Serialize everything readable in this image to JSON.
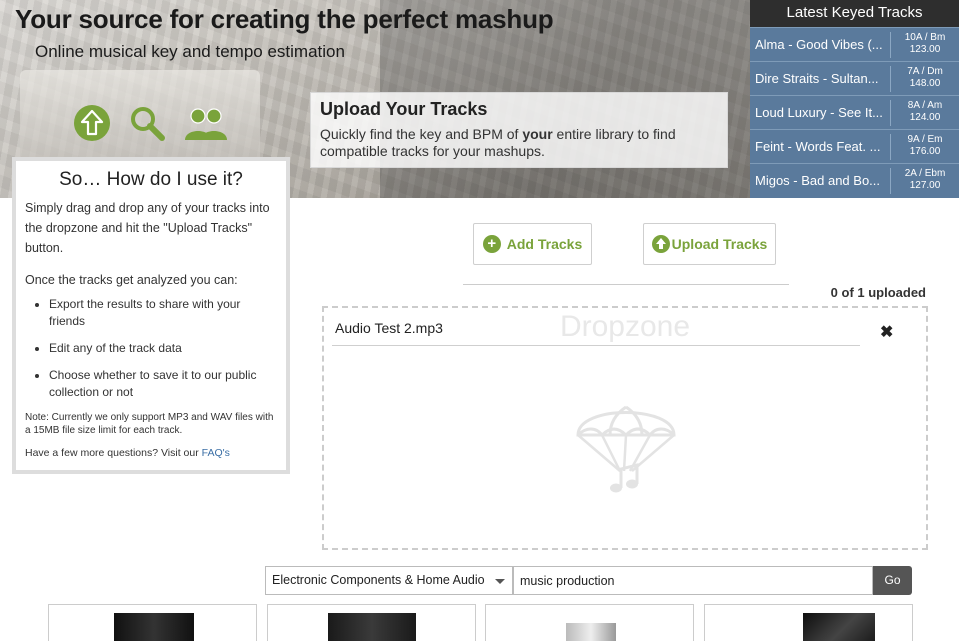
{
  "hero": {
    "title": "Your source for creating the perfect mashup",
    "subtitle": "Online musical key and tempo estimation",
    "icons": [
      "upload-icon",
      "search-icon",
      "users-icon"
    ],
    "accent": "#7aa33b"
  },
  "upload_card": {
    "title": "Upload Your Tracks",
    "text_before": "Quickly find the key and BPM of ",
    "text_bold": "your",
    "text_after": " entire library to find compatible tracks for your mashups."
  },
  "latest": {
    "header": "Latest Keyed Tracks",
    "items": [
      {
        "name": "Alma - Good Vibes (...",
        "key": "10A / Bm",
        "bpm": "123.00"
      },
      {
        "name": "Dire Straits - Sultan...",
        "key": "7A / Dm",
        "bpm": "148.00"
      },
      {
        "name": "Loud Luxury - See It...",
        "key": "8A / Am",
        "bpm": "124.00"
      },
      {
        "name": "Feint - Words Feat. ...",
        "key": "9A / Em",
        "bpm": "176.00"
      },
      {
        "name": "Migos - Bad and Bo...",
        "key": "2A / Ebm",
        "bpm": "127.00"
      }
    ]
  },
  "howto": {
    "title": "So… How do I use it?",
    "intro": "Simply drag and drop any of your tracks into the dropzone and hit the \"Upload Tracks\" button.",
    "after": "Once the tracks get analyzed you can:",
    "bullets": [
      "Export the results to share with your friends",
      "Edit any of the track data",
      "Choose whether to save it to our public collection or not"
    ],
    "note": "Note: Currently we only support MP3 and WAV files with a 15MB file size limit for each track.",
    "faq_prefix": "Have a few more questions? Visit our ",
    "faq_link": "FAQ's"
  },
  "actions": {
    "add_label": "Add Tracks",
    "upload_label": "Upload Tracks",
    "count": "0 of 1 uploaded"
  },
  "dropzone": {
    "label": "Dropzone",
    "file_name": "Audio Test 2.mp3",
    "remove_glyph": "✖"
  },
  "search": {
    "category": "Electronic Components & Home Audio",
    "query": "music production",
    "go_label": "Go"
  }
}
